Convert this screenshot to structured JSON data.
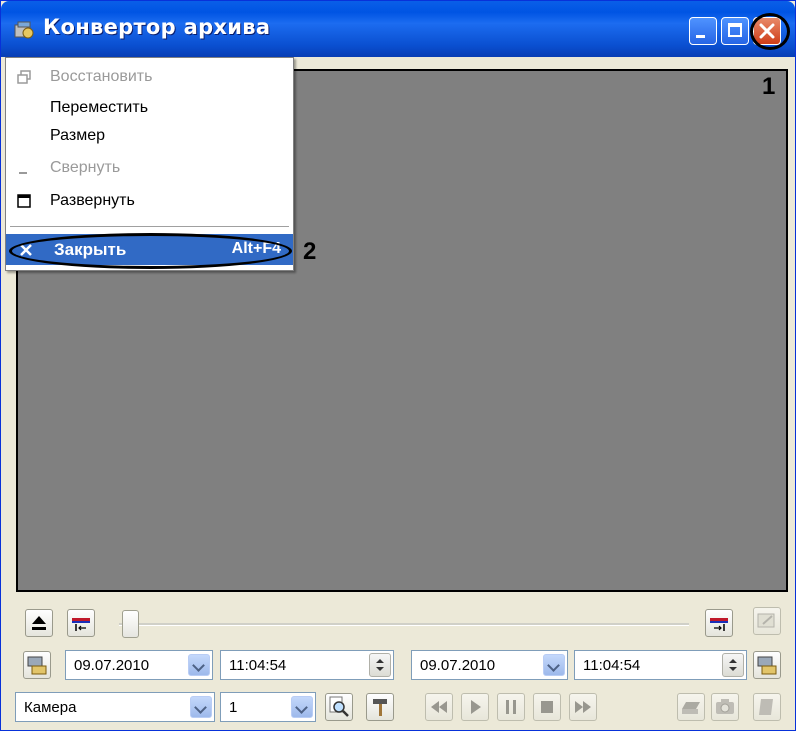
{
  "window": {
    "title": "Конвертор архива"
  },
  "annotations": {
    "marker_1": "1",
    "marker_2": "2"
  },
  "menu": {
    "restore": "Восстановить",
    "move": "Переместить",
    "size": "Размер",
    "minimize": "Свернуть",
    "maximize": "Развернуть",
    "close": "Закрыть",
    "close_shortcut": "Alt+F4"
  },
  "toolbar": {
    "start_date": "09.07.2010",
    "start_time": "11:04:54",
    "end_date": "09.07.2010",
    "end_time": "11:04:54",
    "camera_select": "Камера",
    "camera_number": "1",
    "slider_position": 0.0
  },
  "colors": {
    "titlebar": "#0054e3",
    "video_bg": "#808080",
    "menu_highlight": "#316ac5",
    "close_button": "#cf3d18"
  }
}
